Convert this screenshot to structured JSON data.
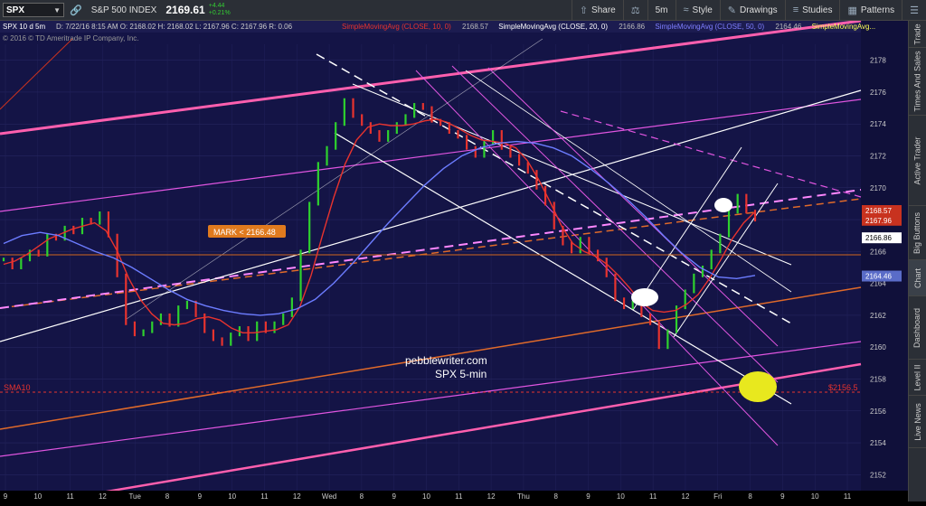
{
  "toolbar": {
    "symbol": "SPX",
    "name": "S&P 500 INDEX",
    "price": "2169.61",
    "change": "+4.44",
    "change_pct": "+0.21%",
    "share": "Share",
    "timeframe": "5m",
    "style": "Style",
    "drawings": "Drawings",
    "studies": "Studies",
    "patterns": "Patterns"
  },
  "header": {
    "sym": "SPX 10 d 5m",
    "ohlc": "D: 7/22/16 8:15 AM   O: 2168.02   H: 2168.02   L: 2167.96   C: 2167.96   R: 0.06",
    "copyright": "© 2016 © TD Ameritrade IP Company, Inc.",
    "studies": [
      {
        "label": "SimpleMovingAvg (CLOSE, 10, 0)",
        "value": "2168.57",
        "color": "#e8332e"
      },
      {
        "label": "SimpleMovingAvg (CLOSE, 20, 0)",
        "value": "2166.86",
        "color": "#ffffff"
      },
      {
        "label": "SimpleMovingAvg (CLOSE, 50, 0)",
        "value": "2164.46",
        "color": "#7f7fff"
      },
      {
        "label": "SimpleMovingAvg...",
        "value": "",
        "color": "#ffff55"
      }
    ]
  },
  "annotations": {
    "mark": "MARK < 2166.48",
    "sma10": "SMA10",
    "level": "$2156.5",
    "watermark_1": "pebblewriter.com",
    "watermark_2": "SPX 5-min"
  },
  "sidebar": [
    "Trade",
    "Times And Sales",
    "Active Trader",
    "Big Buttons",
    "Chart",
    "Dashboard",
    "Level II",
    "Live News"
  ],
  "chart_data": {
    "type": "line",
    "title": "SPX 10 d 5m",
    "ylim": [
      2151,
      2179
    ],
    "y_ticks": [
      2152,
      2154,
      2156,
      2158,
      2160,
      2162,
      2164,
      2166,
      2168,
      2170,
      2172,
      2174,
      2176,
      2178
    ],
    "x_ticks": [
      "9",
      "10",
      "11",
      "12",
      "Tue",
      "8",
      "9",
      "10",
      "11",
      "12",
      "Wed",
      "8",
      "9",
      "10",
      "11",
      "12",
      "Thu",
      "8",
      "9",
      "10",
      "11",
      "12",
      "Fri",
      "8",
      "9",
      "10",
      "11"
    ],
    "price_labels": [
      {
        "value": 2168.57,
        "label": "2168.57",
        "color": "#c8321f"
      },
      {
        "value": 2167.96,
        "label": "2167.96",
        "color": "#c8321f"
      },
      {
        "value": 2166.86,
        "label": "2166.86",
        "color": "#ffffff"
      },
      {
        "value": 2164.46,
        "label": "2164.46",
        "color": "#5a6cc8"
      }
    ],
    "mark_value": 2166.48,
    "level_value": 2156.5,
    "series": [
      {
        "name": "SPX",
        "color": "#2ed12e",
        "values": [
          2165.5,
          2165.0,
          2165.5,
          2166.0,
          2165.8,
          2167.0,
          2166.8,
          2167.5,
          2167.2,
          2168.0,
          2167.8,
          2168.4,
          2167.0,
          2164.5,
          2161.5,
          2160.8,
          2161.0,
          2161.5,
          2162.0,
          2161.4,
          2162.5,
          2162.8,
          2162.0,
          2161.0,
          2160.5,
          2160.2,
          2160.8,
          2161.2,
          2160.5,
          2161.5,
          2161.0,
          2161.5,
          2162.0,
          2163.0,
          2166.0,
          2169.0,
          2171.5,
          2172.5,
          2174.0,
          2175.5,
          2174.5,
          2174.0,
          2173.5,
          2173.0,
          2173.5,
          2174.0,
          2174.5,
          2175.2,
          2175.0,
          2174.2,
          2174.0,
          2173.5,
          2173.2,
          2172.5,
          2172.0,
          2172.8,
          2173.5,
          2172.5,
          2172.0,
          2171.5,
          2171.0,
          2170.0,
          2169.0,
          2167.5,
          2166.5,
          2166.0,
          2166.8,
          2166.0,
          2165.5,
          2164.5,
          2163.0,
          2162.5,
          2162.8,
          2162.0,
          2161.5,
          2160.0,
          2161.0,
          2162.5,
          2163.5,
          2164.5,
          2165.0,
          2166.0,
          2167.0,
          2168.5,
          2169.5,
          2168.5,
          2168.0
        ]
      },
      {
        "name": "SMA10",
        "color": "#e8332e",
        "values": [
          2165.2,
          2165.4,
          2165.8,
          2166.3,
          2166.8,
          2167.1,
          2167.4,
          2167.6,
          2167.8,
          2167.3,
          2166.0,
          2164.3,
          2163.0,
          2162.1,
          2161.5,
          2161.4,
          2161.5,
          2161.8,
          2161.9,
          2161.7,
          2161.2,
          2160.9,
          2160.9,
          2161.0,
          2161.1,
          2161.4,
          2162.5,
          2164.5,
          2167.0,
          2169.4,
          2171.5,
          2173.0,
          2173.8,
          2174.0,
          2173.9,
          2173.9,
          2174.0,
          2174.2,
          2174.3,
          2174.1,
          2173.7,
          2173.3,
          2173.0,
          2172.9,
          2172.8,
          2172.5,
          2171.7,
          2170.5,
          2169.1,
          2167.6,
          2166.5,
          2166.0,
          2165.7,
          2165.2,
          2164.5,
          2163.7,
          2162.8,
          2162.3,
          2162.2,
          2162.3,
          2162.7,
          2163.3,
          2164.3,
          2165.5,
          2166.8,
          2167.8,
          2168.5
        ]
      },
      {
        "name": "SMA50",
        "color": "#6c7cff",
        "values": [
          2166.5,
          2167.0,
          2167.2,
          2167.0,
          2166.5,
          2166.0,
          2165.6,
          2165.0,
          2164.3,
          2163.6,
          2163.0,
          2162.6,
          2162.3,
          2162.1,
          2162.0,
          2162.1,
          2162.4,
          2163.0,
          2164.0,
          2165.2,
          2166.5,
          2167.8,
          2169.0,
          2170.2,
          2171.2,
          2172.0,
          2172.5,
          2172.8,
          2172.9,
          2172.8,
          2172.5,
          2172.0,
          2171.2,
          2170.3,
          2169.3,
          2168.2,
          2167.0,
          2165.9,
          2165.0,
          2164.4,
          2164.3,
          2164.5
        ]
      }
    ]
  }
}
